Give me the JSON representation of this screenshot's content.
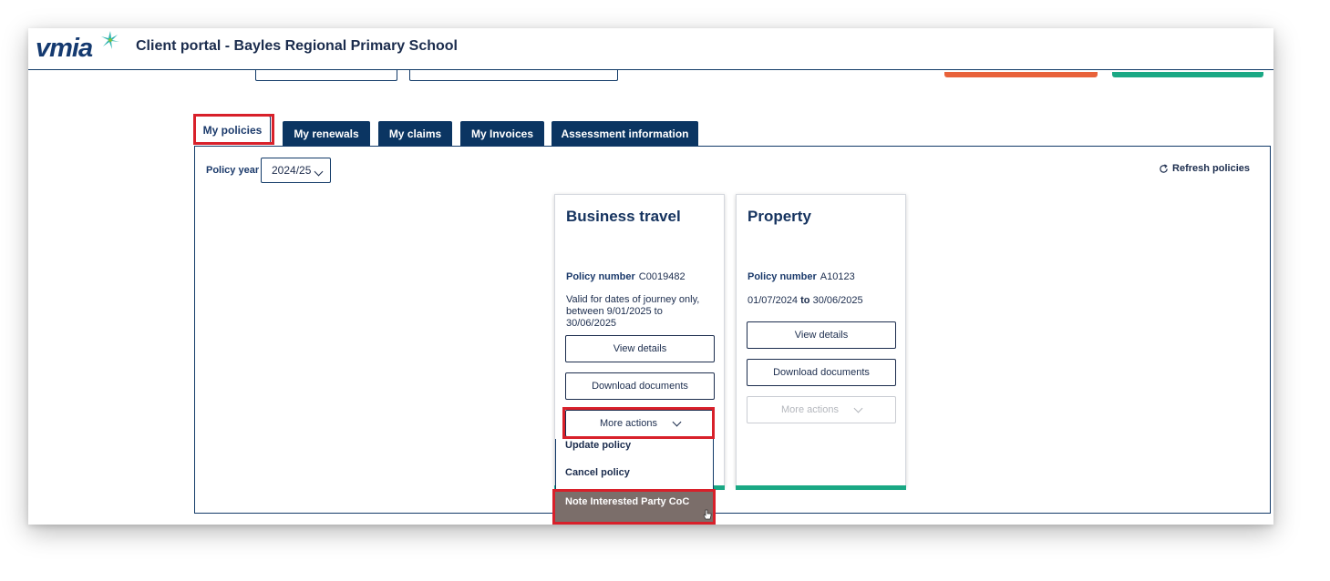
{
  "header": {
    "logo_text": "vmia",
    "portal_title": "Client portal - Bayles Regional Primary School"
  },
  "tabs": [
    {
      "label": "My policies",
      "active": true
    },
    {
      "label": "My renewals"
    },
    {
      "label": "My claims"
    },
    {
      "label": "My Invoices"
    },
    {
      "label": "Assessment information"
    }
  ],
  "filters": {
    "policy_year_label": "Policy year",
    "policy_year_value": "2024/25",
    "refresh_label": "Refresh policies"
  },
  "cards": [
    {
      "title": "Business travel",
      "policy_number_label": "Policy number",
      "policy_number": "C0019482",
      "validity_text": "Valid for dates of journey only, between  9/01/2025  to 30/06/2025",
      "view_details": "View details",
      "download_documents": "Download documents",
      "more_actions": "More actions"
    },
    {
      "title": "Property",
      "policy_number_label": "Policy number",
      "policy_number": "A10123",
      "date_from": "01/07/2024",
      "date_to_word": "to",
      "date_to": "30/06/2025",
      "view_details": "View details",
      "download_documents": "Download documents",
      "more_actions": "More actions"
    }
  ],
  "more_actions_menu": [
    {
      "label": "Update policy"
    },
    {
      "label": "Cancel policy"
    },
    {
      "label": "Note Interested Party CoC",
      "highlighted": true
    }
  ],
  "colors": {
    "navy": "#0b3562",
    "accent_green": "#1aa884",
    "accent_orange": "#e8623a",
    "highlight_box": "#d8202a"
  }
}
